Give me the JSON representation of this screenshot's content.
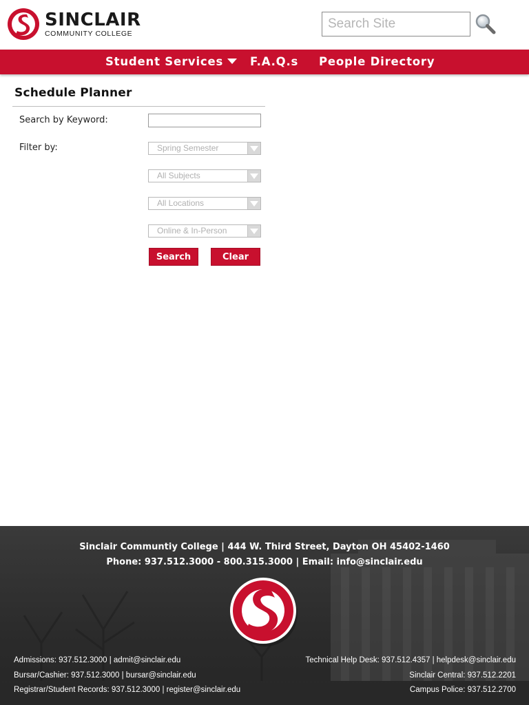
{
  "brand": {
    "name": "SINCLAIR",
    "subtitle": "COMMUNITY COLLEGE",
    "primary_color": "#c8102e"
  },
  "search": {
    "placeholder": "Search Site",
    "icon": "magnifier-icon"
  },
  "nav": {
    "items": [
      {
        "label": "Student Services",
        "has_dropdown": true
      },
      {
        "label": "F.A.Q.s"
      },
      {
        "label": "People Directory"
      }
    ]
  },
  "planner": {
    "title": "Schedule Planner",
    "keyword_label": "Search by Keyword:",
    "keyword_value": "",
    "filter_label": "Filter by:",
    "filters": [
      {
        "selected": "Spring Semester"
      },
      {
        "selected": "All Subjects"
      },
      {
        "selected": "All Locations"
      },
      {
        "selected": "Online & In-Person"
      }
    ],
    "search_label": "Search",
    "clear_label": "Clear"
  },
  "footer": {
    "address_line": "Sinclair Communtiy College | 444 W. Third Street, Dayton OH 45402-1460",
    "contact_line": "Phone: 937.512.3000 - 800.315.3000 | Email: info@sinclair.edu",
    "left_contacts": [
      "Admissions: 937.512.3000 | admit@sinclair.edu",
      "Bursar/Cashier: 937.512.3000 | bursar@sinclair.edu",
      "Registrar/Student Records: 937.512.3000 | register@sinclair.edu"
    ],
    "right_contacts": [
      "Technical Help Desk: 937.512.4357 | helpdesk@sinclair.edu",
      "Sinclair Central: 937.512.2201",
      "Campus Police: 937.512.2700"
    ]
  }
}
